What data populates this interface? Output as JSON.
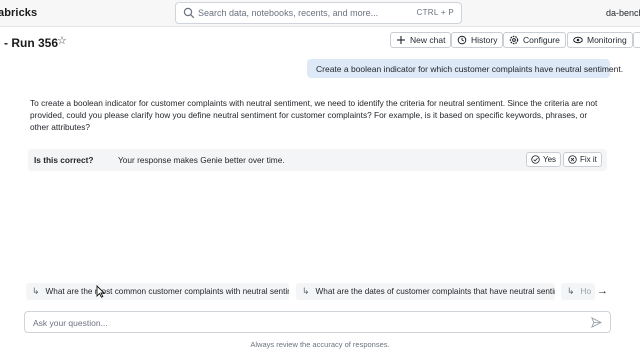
{
  "topbar": {
    "brand": "abricks",
    "search_placeholder": "Search data, notebooks, recents, and more...",
    "search_shortcut": "CTRL + P",
    "user": "da-bench"
  },
  "header": {
    "title": "- Run 356",
    "buttons": {
      "new_chat": "New chat",
      "history": "History",
      "configure": "Configure",
      "monitoring": "Monitoring"
    }
  },
  "conversation": {
    "user_message": "Create a boolean indicator for which customer complaints have neutral sentiment.",
    "assistant_message": "To create a boolean indicator for customer complaints with neutral sentiment, we need to identify the criteria for neutral sentiment. Since the criteria are not provided, could you please clarify how you define neutral sentiment for customer complaints? For example, is it based on specific keywords, phrases, or other attributes?"
  },
  "feedback": {
    "question": "Is this correct?",
    "text": "Your response makes Genie better over time.",
    "yes_label": "Yes",
    "fix_label": "Fix it"
  },
  "suggestions": [
    "What are the most common customer complaints with neutral sentiment?",
    "What are the dates of customer complaints that have neutral sentiment?",
    "Ho"
  ],
  "composer": {
    "placeholder": "Ask your question...",
    "disclaimer": "Always review the accuracy of responses."
  }
}
